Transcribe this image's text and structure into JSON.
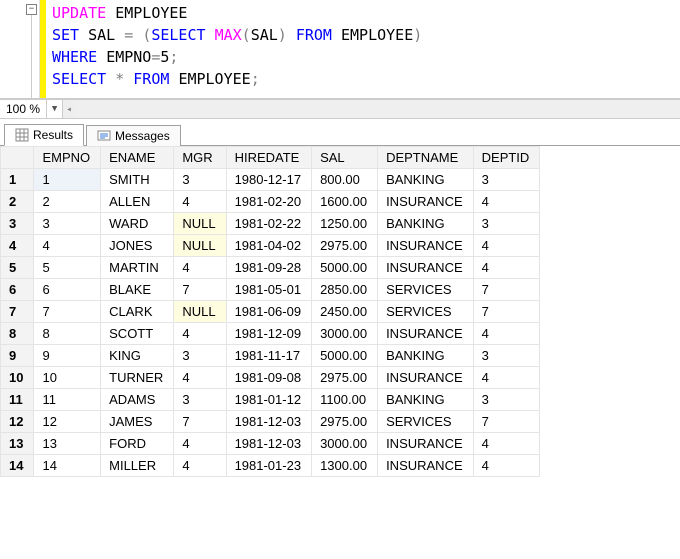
{
  "editor": {
    "lines": [
      [
        {
          "t": "UPDATE",
          "c": "kw-pink"
        },
        {
          "t": " ",
          "c": ""
        },
        {
          "t": "EMPLOYEE",
          "c": "kw-black"
        }
      ],
      [
        {
          "t": "SET",
          "c": "kw-blue"
        },
        {
          "t": " ",
          "c": ""
        },
        {
          "t": "SAL",
          "c": "kw-black"
        },
        {
          "t": " ",
          "c": ""
        },
        {
          "t": "=",
          "c": "kw-gray"
        },
        {
          "t": " ",
          "c": ""
        },
        {
          "t": "(",
          "c": "kw-gray"
        },
        {
          "t": "SELECT",
          "c": "kw-blue"
        },
        {
          "t": " ",
          "c": ""
        },
        {
          "t": "MAX",
          "c": "kw-pink"
        },
        {
          "t": "(",
          "c": "kw-gray"
        },
        {
          "t": "SAL",
          "c": "kw-black"
        },
        {
          "t": ")",
          "c": "kw-gray"
        },
        {
          "t": " ",
          "c": ""
        },
        {
          "t": "FROM",
          "c": "kw-blue"
        },
        {
          "t": " ",
          "c": ""
        },
        {
          "t": "EMPLOYEE",
          "c": "kw-black"
        },
        {
          "t": ")",
          "c": "kw-gray"
        }
      ],
      [
        {
          "t": "WHERE",
          "c": "kw-blue"
        },
        {
          "t": " ",
          "c": ""
        },
        {
          "t": "EMPNO",
          "c": "kw-black"
        },
        {
          "t": "=",
          "c": "kw-gray"
        },
        {
          "t": "5",
          "c": "kw-num"
        },
        {
          "t": ";",
          "c": "kw-gray"
        }
      ],
      [
        {
          "t": "SELECT",
          "c": "kw-blue"
        },
        {
          "t": " ",
          "c": ""
        },
        {
          "t": "*",
          "c": "kw-gray"
        },
        {
          "t": " ",
          "c": ""
        },
        {
          "t": "FROM",
          "c": "kw-blue"
        },
        {
          "t": " ",
          "c": ""
        },
        {
          "t": "EMPLOYEE",
          "c": "kw-black"
        },
        {
          "t": ";",
          "c": "kw-gray"
        }
      ]
    ]
  },
  "zoom": {
    "value": "100 %"
  },
  "tabs": {
    "results": "Results",
    "messages": "Messages"
  },
  "grid": {
    "columns": [
      "EMPNO",
      "ENAME",
      "MGR",
      "HIREDATE",
      "SAL",
      "DEPTNAME",
      "DEPTID"
    ],
    "null_text": "NULL",
    "rows": [
      {
        "n": "1",
        "EMPNO": "1",
        "ENAME": "SMITH",
        "MGR": "3",
        "HIREDATE": "1980-12-17",
        "SAL": "800.00",
        "DEPTNAME": "BANKING",
        "DEPTID": "3"
      },
      {
        "n": "2",
        "EMPNO": "2",
        "ENAME": "ALLEN",
        "MGR": "4",
        "HIREDATE": "1981-02-20",
        "SAL": "1600.00",
        "DEPTNAME": "INSURANCE",
        "DEPTID": "4"
      },
      {
        "n": "3",
        "EMPNO": "3",
        "ENAME": "WARD",
        "MGR": null,
        "HIREDATE": "1981-02-22",
        "SAL": "1250.00",
        "DEPTNAME": "BANKING",
        "DEPTID": "3"
      },
      {
        "n": "4",
        "EMPNO": "4",
        "ENAME": "JONES",
        "MGR": null,
        "HIREDATE": "1981-04-02",
        "SAL": "2975.00",
        "DEPTNAME": "INSURANCE",
        "DEPTID": "4"
      },
      {
        "n": "5",
        "EMPNO": "5",
        "ENAME": "MARTIN",
        "MGR": "4",
        "HIREDATE": "1981-09-28",
        "SAL": "5000.00",
        "DEPTNAME": "INSURANCE",
        "DEPTID": "4"
      },
      {
        "n": "6",
        "EMPNO": "6",
        "ENAME": "BLAKE",
        "MGR": "7",
        "HIREDATE": "1981-05-01",
        "SAL": "2850.00",
        "DEPTNAME": "SERVICES",
        "DEPTID": "7"
      },
      {
        "n": "7",
        "EMPNO": "7",
        "ENAME": "CLARK",
        "MGR": null,
        "HIREDATE": "1981-06-09",
        "SAL": "2450.00",
        "DEPTNAME": "SERVICES",
        "DEPTID": "7"
      },
      {
        "n": "8",
        "EMPNO": "8",
        "ENAME": "SCOTT",
        "MGR": "4",
        "HIREDATE": "1981-12-09",
        "SAL": "3000.00",
        "DEPTNAME": "INSURANCE",
        "DEPTID": "4"
      },
      {
        "n": "9",
        "EMPNO": "9",
        "ENAME": "KING",
        "MGR": "3",
        "HIREDATE": "1981-11-17",
        "SAL": "5000.00",
        "DEPTNAME": "BANKING",
        "DEPTID": "3"
      },
      {
        "n": "10",
        "EMPNO": "10",
        "ENAME": "TURNER",
        "MGR": "4",
        "HIREDATE": "1981-09-08",
        "SAL": "2975.00",
        "DEPTNAME": "INSURANCE",
        "DEPTID": "4"
      },
      {
        "n": "11",
        "EMPNO": "11",
        "ENAME": "ADAMS",
        "MGR": "3",
        "HIREDATE": "1981-01-12",
        "SAL": "1100.00",
        "DEPTNAME": "BANKING",
        "DEPTID": "3"
      },
      {
        "n": "12",
        "EMPNO": "12",
        "ENAME": "JAMES",
        "MGR": "7",
        "HIREDATE": "1981-12-03",
        "SAL": "2975.00",
        "DEPTNAME": "SERVICES",
        "DEPTID": "7"
      },
      {
        "n": "13",
        "EMPNO": "13",
        "ENAME": "FORD",
        "MGR": "4",
        "HIREDATE": "1981-12-03",
        "SAL": "3000.00",
        "DEPTNAME": "INSURANCE",
        "DEPTID": "4"
      },
      {
        "n": "14",
        "EMPNO": "14",
        "ENAME": "MILLER",
        "MGR": "4",
        "HIREDATE": "1981-01-23",
        "SAL": "1300.00",
        "DEPTNAME": "INSURANCE",
        "DEPTID": "4"
      }
    ]
  }
}
